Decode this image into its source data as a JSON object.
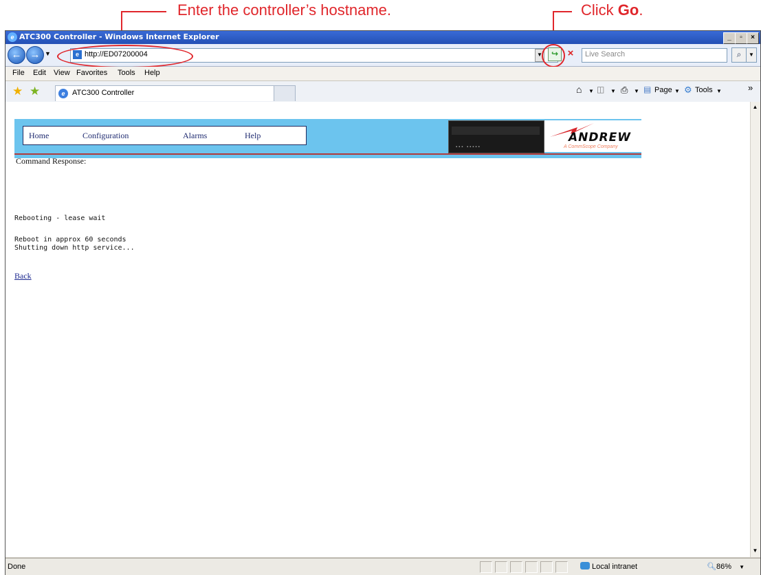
{
  "callouts": {
    "hostname_text": "Enter the controller’s hostname.",
    "go_text_prefix": "Click ",
    "go_text_bold": "Go",
    "go_text_suffix": ".",
    "color": "#e0262b"
  },
  "window": {
    "title": "ATC300 Controller - Windows Internet Explorer",
    "minimize": "_",
    "restore": "▫",
    "close": "×"
  },
  "address_bar": {
    "url": "http://ED07200004",
    "search_placeholder": "Live Search"
  },
  "menu": [
    "File",
    "Edit",
    "View",
    "Favorites",
    "Tools",
    "Help"
  ],
  "tab": {
    "title": "ATC300 Controller"
  },
  "command_bar": {
    "page_label": "Page",
    "tools_label": "Tools",
    "more": "»"
  },
  "page": {
    "nav": [
      "Home",
      "Configuration",
      "Alarms",
      "Help"
    ],
    "logo_word": "ANDREW",
    "logo_tagline": "A CommScope Company",
    "section_label": "Command Response:",
    "lines": [
      "Rebooting - lease wait",
      "Reboot in approx 60 seconds",
      "Shutting down http service..."
    ],
    "back_link": "Back",
    "banner_color": "#6cc4ee"
  },
  "status_bar": {
    "status": "Done",
    "zone": "Local intranet",
    "zoom": "86%"
  }
}
